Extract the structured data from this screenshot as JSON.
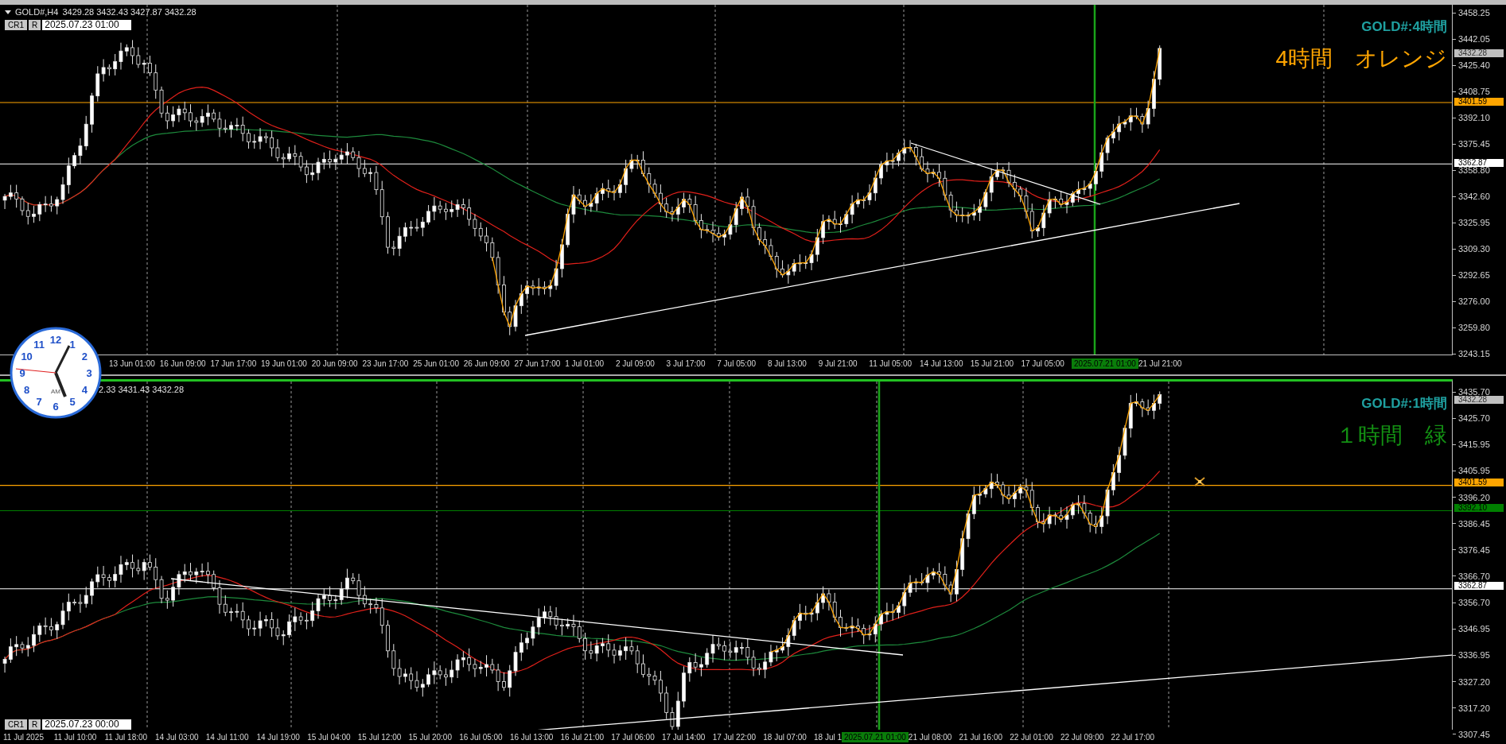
{
  "panels": [
    {
      "active": false,
      "symbol": "GOLD#,H4",
      "quote": "3429.28 3432.43 3427.87 3432.28",
      "tool_row": {
        "buttons": [
          "CR1",
          "R"
        ],
        "datetime": "2025.07.23 01:00"
      },
      "title": "GOLD#:4時間",
      "subtitle": "4時間　オレンジ",
      "color": "#ffa500",
      "price_ticks": [
        "3458.25",
        "3442.05",
        "3425.40",
        "3408.75",
        "3392.10",
        "3375.45",
        "3358.80",
        "3342.60",
        "3325.95",
        "3309.30",
        "3292.65",
        "3276.00",
        "3259.80",
        "3243.15"
      ],
      "price_markers": [
        {
          "text": "3432.28",
          "color": "#c0c0c0",
          "line": false
        },
        {
          "text": "3401.59",
          "color": "#ffa500",
          "line": true
        },
        {
          "text": "3362.87",
          "color": "#ffffff",
          "line": true
        }
      ],
      "time_labels": [
        {
          "text": "13 Jun 01:00",
          "kind": "date"
        },
        {
          "text": "16 Jun 09:00",
          "kind": "date"
        },
        {
          "text": "17 Jun 17:00",
          "kind": "date"
        },
        {
          "text": "19 Jun 01:00",
          "kind": "date"
        },
        {
          "text": "20 Jun 09:00",
          "kind": "date"
        },
        {
          "text": "23 Jun 17:00",
          "kind": "date"
        },
        {
          "text": "25 Jun 01:00",
          "kind": "date"
        },
        {
          "text": "26 Jun 09:00",
          "kind": "date"
        },
        {
          "text": "27 Jun 17:00",
          "kind": "date"
        },
        {
          "text": "1 Jul 01:00",
          "kind": "date"
        },
        {
          "text": "2 Jul 09:00",
          "kind": "date"
        },
        {
          "text": "3 Jul 17:00",
          "kind": "date"
        },
        {
          "text": "7 Jul 05:00",
          "kind": "date"
        },
        {
          "text": "8 Jul 13:00",
          "kind": "date"
        },
        {
          "text": "9 Jul 21:00",
          "kind": "date"
        },
        {
          "text": "11 Jul 05:00",
          "kind": "date"
        },
        {
          "text": "14 Jul 13:00",
          "kind": "date"
        },
        {
          "text": "15 Jul 21:00",
          "kind": "date"
        },
        {
          "text": "17 Jul 05:00",
          "kind": "date"
        },
        {
          "text": "2025.07.21 01:00",
          "kind": "cursor"
        },
        {
          "text": "21 Jul 21:00",
          "kind": "date"
        }
      ]
    },
    {
      "active": true,
      "quote": "2.33 3431.43 3432.28",
      "tool_row": {
        "buttons": [
          "CR1",
          "R"
        ],
        "datetime": "2025.07.23 00:00"
      },
      "title": "GOLD#:1時間",
      "subtitle": "１時間　緑",
      "color": "#139013",
      "price_ticks": [
        "3435.70",
        "3425.70",
        "3415.95",
        "3405.95",
        "3396.20",
        "3386.45",
        "3376.45",
        "3366.70",
        "3356.70",
        "3346.95",
        "3336.95",
        "3327.20",
        "3317.20",
        "3307.45"
      ],
      "price_markers": [
        {
          "text": "3432.28",
          "color": "#c0c0c0",
          "line": false
        },
        {
          "text": "3401.59",
          "color": "#ffa500",
          "line": true
        },
        {
          "text": "3392.10",
          "color": "#008000",
          "line": true
        },
        {
          "text": "3362.87",
          "color": "#ffffff",
          "line": true
        }
      ],
      "time_labels": [
        {
          "text": "11 Jul 2025",
          "kind": "date"
        },
        {
          "text": "11 Jul 10:00",
          "kind": "date"
        },
        {
          "text": "11 Jul 18:00",
          "kind": "date"
        },
        {
          "text": "14 Jul 03:00",
          "kind": "date"
        },
        {
          "text": "14 Jul 11:00",
          "kind": "date"
        },
        {
          "text": "14 Jul 19:00",
          "kind": "date"
        },
        {
          "text": "15 Jul 04:00",
          "kind": "date"
        },
        {
          "text": "15 Jul 12:00",
          "kind": "date"
        },
        {
          "text": "15 Jul 20:00",
          "kind": "date"
        },
        {
          "text": "16 Jul 05:00",
          "kind": "date"
        },
        {
          "text": "16 Jul 13:00",
          "kind": "date"
        },
        {
          "text": "16 Jul 21:00",
          "kind": "date"
        },
        {
          "text": "17 Jul 06:00",
          "kind": "date"
        },
        {
          "text": "17 Jul 14:00",
          "kind": "date"
        },
        {
          "text": "17 Jul 22:00",
          "kind": "date"
        },
        {
          "text": "18 Jul 07:00",
          "kind": "date"
        },
        {
          "text": "18 Jul 1",
          "kind": "partial"
        },
        {
          "text": "2025.07.21 01:00",
          "kind": "cursor"
        },
        {
          "text": "21 Jul 08:00",
          "kind": "date"
        },
        {
          "text": "21 Jul 16:00",
          "kind": "date"
        },
        {
          "text": "22 Jul 01:00",
          "kind": "date"
        },
        {
          "text": "22 Jul 09:00",
          "kind": "date"
        },
        {
          "text": "22 Jul 17:00",
          "kind": "date"
        }
      ]
    }
  ],
  "clock": {
    "numerals": [
      "12",
      "11",
      "1",
      "10",
      "2",
      "9",
      "3",
      "8",
      "4",
      "7",
      "5",
      "6"
    ],
    "period": "AM"
  }
}
